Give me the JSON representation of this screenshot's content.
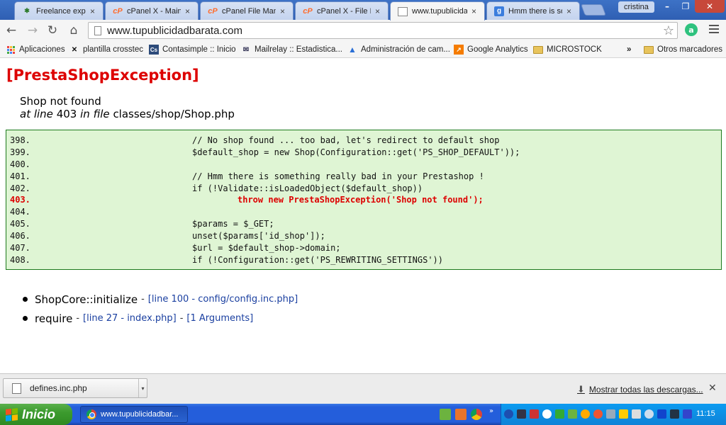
{
  "browser": {
    "tabs": [
      {
        "title": "Freelance experi",
        "favicon": "freelance-icon",
        "active": false
      },
      {
        "title": "cPanel X - Main",
        "favicon": "cpanel-icon",
        "active": false
      },
      {
        "title": "cPanel File Mana",
        "favicon": "cpanel-icon",
        "active": false
      },
      {
        "title": "cPanel X - File M",
        "favicon": "cpanel-icon",
        "active": false
      },
      {
        "title": "www.tupublicida",
        "favicon": "page-icon",
        "active": true
      },
      {
        "title": "Hmm there is sor",
        "favicon": "google-icon",
        "active": false
      }
    ],
    "tab_close_glyph": "×",
    "user": "cristina",
    "window_buttons": {
      "minimize": "–",
      "maximize": "❐",
      "close": "✕"
    },
    "nav": {
      "back": "←",
      "forward": "→",
      "reload": "↻",
      "home": "⌂"
    },
    "url": "www.tupublicidadbarata.com",
    "star_glyph": "☆",
    "bookmarks": [
      {
        "label": "Aplicaciones",
        "icon": "apps-grid-icon"
      },
      {
        "label": "plantilla crosstec",
        "icon": "crosstec-icon"
      },
      {
        "label": "Contasimple :: Inicio",
        "icon": "contasimple-icon"
      },
      {
        "label": "Mailrelay :: Estadistica...",
        "icon": "mail-icon"
      },
      {
        "label": "Administración de cam...",
        "icon": "adwords-icon"
      },
      {
        "label": "Google Analytics",
        "icon": "analytics-icon"
      },
      {
        "label": "MICROSTOCK",
        "icon": "folder-icon"
      }
    ],
    "bookmarks_overflow": "»",
    "other_bookmarks": "Otros marcadores"
  },
  "page": {
    "exception_title": "[PrestaShopException]",
    "message": "Shop not found",
    "location": {
      "at_line_label": "at line",
      "line": "403",
      "in_file_label": "in file",
      "file": "classes/shop/Shop.php"
    },
    "code_lines": [
      {
        "num": "398.",
        "code": "// No shop found ... too bad, let's redirect to default shop",
        "error": false
      },
      {
        "num": "399.",
        "code": "$default_shop = new Shop(Configuration::get('PS_SHOP_DEFAULT'));",
        "error": false
      },
      {
        "num": "400.",
        "code": "",
        "error": false
      },
      {
        "num": "401.",
        "code": "// Hmm there is something really bad in your Prestashop !",
        "error": false
      },
      {
        "num": "402.",
        "code": "if (!Validate::isLoadedObject($default_shop))",
        "error": false
      },
      {
        "num": "403.",
        "code": "throw new PrestaShopException('Shop not found');",
        "error": true
      },
      {
        "num": "404.",
        "code": "",
        "error": false
      },
      {
        "num": "405.",
        "code": "$params = $_GET;",
        "error": false
      },
      {
        "num": "406.",
        "code": "unset($params['id_shop']);",
        "error": false
      },
      {
        "num": "407.",
        "code": "$url = $default_shop->domain;",
        "error": false
      },
      {
        "num": "408.",
        "code": "if (!Configuration::get('PS_REWRITING_SETTINGS'))",
        "error": false
      }
    ],
    "trace": [
      {
        "function": "ShopCore::initialize",
        "links": [
          "[line 100 - config/config.inc.php]"
        ]
      },
      {
        "function": "require",
        "links": [
          "[line 27 - index.php]",
          "[1 Arguments]"
        ]
      }
    ],
    "trace_separator": "-"
  },
  "downloads": {
    "file": "defines.inc.php",
    "dropdown_glyph": "▾",
    "show_all": "Mostrar todas las descargas...",
    "close_glyph": "✕"
  },
  "taskbar": {
    "start_label": "Inicio",
    "task_label": "www.tupublicidadbar...",
    "clock": "11:15"
  }
}
